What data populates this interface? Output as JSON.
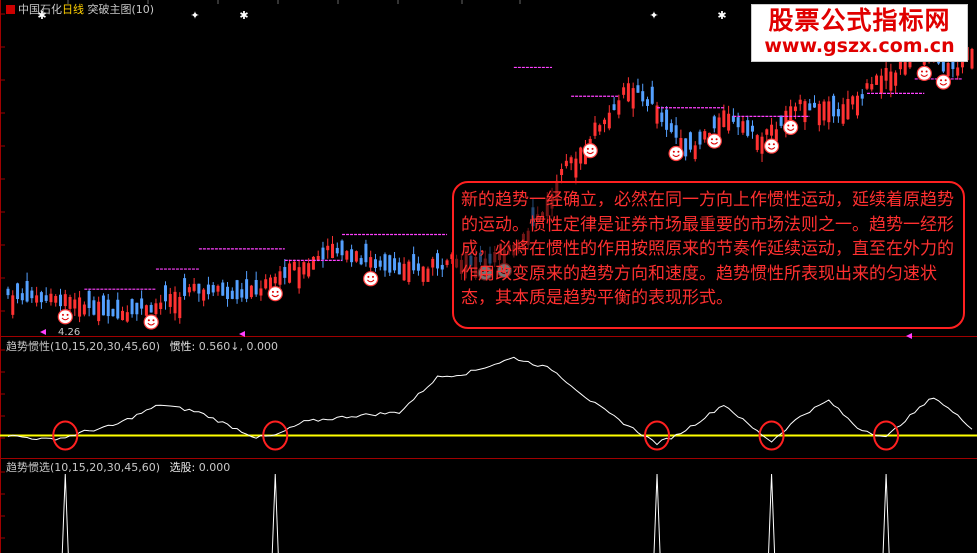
{
  "main_panel": {
    "icon": "stock-flag-icon",
    "stock_name": "中国石化",
    "period": "日线",
    "indicator_name": "突破主图(10)",
    "low_marker": "4.26"
  },
  "indicator1": {
    "header": "趋势惯性(10,15,20,30,45,60)",
    "value_label": "惯性:",
    "value_main": "0.560",
    "value_arrow": "↓",
    "value_ref": "0.000"
  },
  "indicator2": {
    "header": "趋势惯选(10,15,20,30,45,60)",
    "value_label": "选股:",
    "value": "0.000"
  },
  "watermark": {
    "title": "股票公式指标网",
    "url": "www.gszx.com.cn"
  },
  "annotation": {
    "text": "新的趋势一经确立，必然在同一方向上作惯性运动，延续着原趋势的运动。惯性定律是证券市场最重要的市场法则之一。趋势一经形成，必将在惯性的作用按照原来的节奏作延续运动，直至在外力的作用改变原来的趋势方向和速度。趋势惯性所表现出来的匀速状态，其本质是趋势平衡的表现形式。"
  },
  "colors": {
    "up_candle": "#ff3232",
    "down_candle": "#54a0ff",
    "neutral_candle": "#bbbbbb",
    "resistance": "#ff40ff",
    "inertia_line": "#ffffff",
    "zero_line": "#ffff00",
    "circle": "#ff2020",
    "smiley": "#ffffff",
    "separator": "#a00000"
  },
  "chart_data": [
    {
      "type": "candlestick",
      "title": "中国石化 日线 突破主图(10)",
      "price_low": 4.26,
      "y_range": [
        0,
        100
      ],
      "trend_waypoints": {
        "x": [
          0,
          12,
          22,
          30,
          40,
          50,
          58,
          68,
          78,
          86,
          94,
          104,
          112,
          118,
          124,
          130,
          136,
          142,
          150,
          158,
          166,
          174,
          182,
          190,
          198,
          202
        ],
        "close": [
          8,
          6,
          2,
          4,
          10,
          8,
          16,
          24,
          18,
          17,
          20,
          22,
          38,
          55,
          68,
          80,
          72,
          58,
          70,
          62,
          75,
          72,
          82,
          92,
          86,
          95
        ]
      },
      "breakout_levels": [
        {
          "start": 16,
          "end": 31,
          "level": 10
        },
        {
          "start": 31,
          "end": 40,
          "level": 17
        },
        {
          "start": 40,
          "end": 58,
          "level": 24
        },
        {
          "start": 58,
          "end": 70,
          "level": 20
        },
        {
          "start": 70,
          "end": 92,
          "level": 29
        },
        {
          "start": 106,
          "end": 114,
          "level": 87
        },
        {
          "start": 118,
          "end": 128,
          "level": 77
        },
        {
          "start": 136,
          "end": 150,
          "level": 73
        },
        {
          "start": 152,
          "end": 168,
          "level": 70
        },
        {
          "start": 180,
          "end": 192,
          "level": 78
        },
        {
          "start": 190,
          "end": 200,
          "level": 83
        }
      ],
      "buy_signals": [
        12,
        30,
        56,
        76,
        100,
        104,
        122,
        140,
        148,
        160,
        164,
        192,
        196
      ]
    },
    {
      "type": "line",
      "name": "惯性",
      "baseline": 0,
      "x": [
        0,
        8,
        12,
        16,
        22,
        32,
        40,
        52,
        56,
        62,
        72,
        82,
        90,
        96,
        106,
        114,
        122,
        128,
        136,
        140,
        144,
        150,
        156,
        160,
        166,
        172,
        178,
        184,
        188,
        194,
        202
      ],
      "values": [
        0.0,
        -0.1,
        -0.05,
        0.1,
        0.25,
        0.8,
        0.6,
        -0.05,
        0.0,
        0.35,
        0.5,
        0.6,
        1.5,
        1.6,
        2.0,
        1.7,
        0.9,
        0.4,
        -0.2,
        0.0,
        0.3,
        0.8,
        0.2,
        -0.15,
        0.5,
        0.9,
        0.2,
        -0.05,
        0.4,
        1.0,
        0.2
      ]
    },
    {
      "type": "spike",
      "name": "选股",
      "x": [
        12,
        56,
        136,
        160,
        184
      ],
      "values": [
        1,
        1,
        1,
        1,
        1
      ]
    }
  ]
}
